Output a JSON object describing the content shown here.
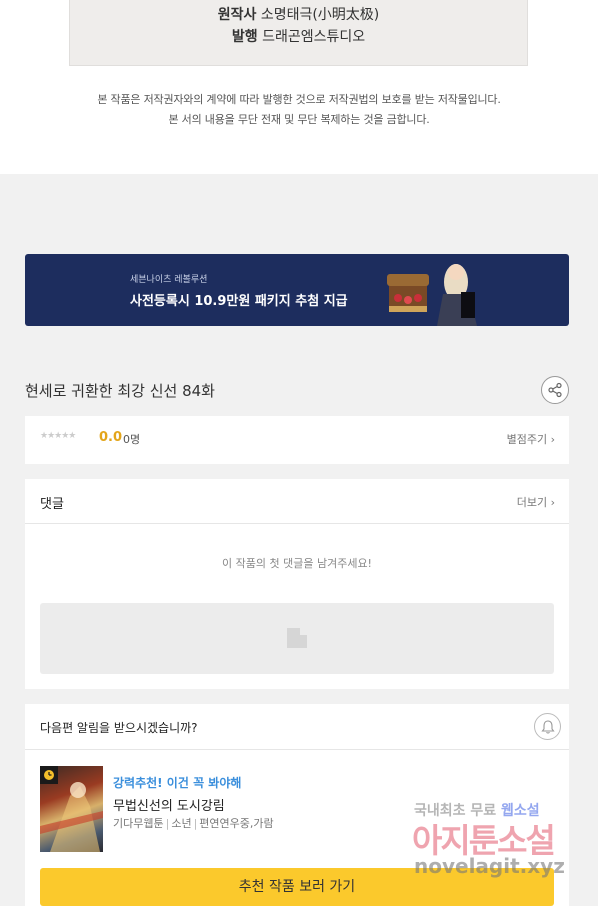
{
  "credits": {
    "author_label": "원작사",
    "author_value": "소명태극(小明太极)",
    "publisher_label": "발행",
    "publisher_value": "드래곤엠스튜디오"
  },
  "copyright": {
    "line1": "본 작품은 저작권자와의 계약에 따라 발행한 것으로 저작권법의 보호를 받는 저작물입니다.",
    "line2": "본 서의 내용을 무단 전재 및 무단 복제하는 것을 금합니다."
  },
  "banner": {
    "subtitle": "세븐나이츠 레볼루션",
    "title": "사전등록시 10.9만원 패키지 추첨 지급",
    "background_color": "#1d2d5e"
  },
  "episode": {
    "title": "현세로 귀환한 최강 신선 84화",
    "share_icon": "share-icon"
  },
  "rating": {
    "stars": "★★★★★",
    "star_value": 0,
    "score": "0.0",
    "count": "0명",
    "rate_link": "별점주기 ›"
  },
  "comments": {
    "title": "댓글",
    "more_link": "더보기 ›",
    "empty_message": "이 작품의 첫 댓글을 남겨주세요!"
  },
  "notify": {
    "title": "다음편 알림을 받으시겠습니까?",
    "bell_icon": "bell-icon"
  },
  "recommendation": {
    "tag": "강력추천! 이건 꼭 봐야해",
    "title": "무법신선의 도시강림",
    "meta_publisher": "기다무웹툰",
    "meta_genre": "소년",
    "meta_status": "편연연우중,가람",
    "cta_label": "추천 작품 보러 가기",
    "cta_color": "#fbc92c",
    "tag_color": "#3b8fdc"
  },
  "watermark": {
    "line1_a": "국내최초 무료",
    "line1_b": "웹소설",
    "line2": "아지툰소설",
    "line3": "novelagit.xyz"
  }
}
